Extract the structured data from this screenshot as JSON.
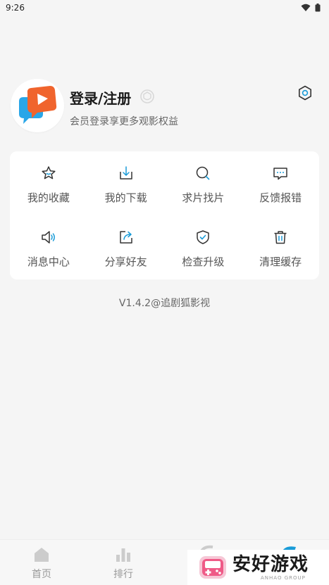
{
  "status_bar": {
    "time": "9:26"
  },
  "profile": {
    "title": "登录/注册",
    "subtitle": "会员登录享更多观影权益"
  },
  "menu": {
    "items": [
      {
        "label": "我的收藏",
        "icon": "star-icon"
      },
      {
        "label": "我的下载",
        "icon": "download-icon"
      },
      {
        "label": "求片找片",
        "icon": "search-icon"
      },
      {
        "label": "反馈报错",
        "icon": "feedback-icon"
      },
      {
        "label": "消息中心",
        "icon": "speaker-icon"
      },
      {
        "label": "分享好友",
        "icon": "share-icon"
      },
      {
        "label": "检查升级",
        "icon": "shield-check-icon"
      },
      {
        "label": "清理缓存",
        "icon": "trash-icon"
      }
    ]
  },
  "version": "V1.4.2@追剧狐影视",
  "bottom_nav": {
    "items": [
      {
        "label": "首页",
        "icon": "home-icon"
      },
      {
        "label": "排行",
        "icon": "chart-icon"
      }
    ]
  },
  "watermark": {
    "title": "安好游戏",
    "subtitle": "ANHAO GROUP"
  },
  "colors": {
    "accent": "#1a9cd8",
    "brand_orange": "#f0642d",
    "brand_blue": "#29a6e8"
  }
}
